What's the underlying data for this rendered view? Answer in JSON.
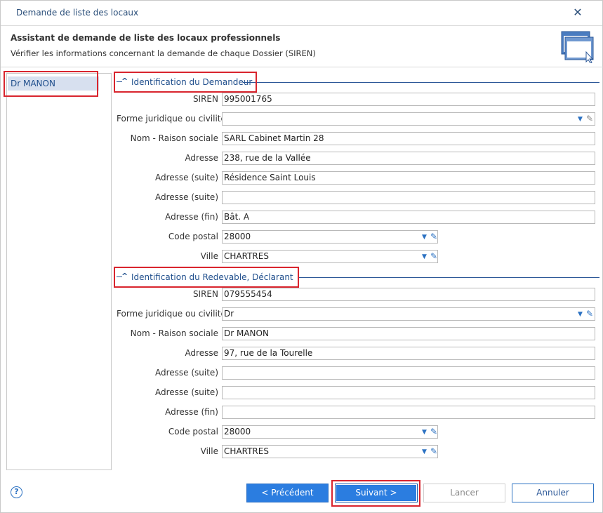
{
  "window": {
    "title": "Demande de liste des locaux",
    "close_label": "✕"
  },
  "header": {
    "title": "Assistant de demande de liste des locaux professionnels",
    "subtitle": "Vérifier les informations concernant la demande de chaque Dossier (SIREN)",
    "icon": "window-cursor-icon"
  },
  "sidebar": {
    "items": [
      {
        "label": "Dr MANON",
        "selected": true
      }
    ]
  },
  "section1": {
    "title": "Identification du Demandeur",
    "fields": {
      "siren": {
        "label": "SIREN",
        "value": "995001765"
      },
      "forme": {
        "label": "Forme juridique ou civilité",
        "value": ""
      },
      "nom": {
        "label": "Nom - Raison sociale",
        "value": "SARL Cabinet Martin 28"
      },
      "adresse": {
        "label": "Adresse",
        "value": "238, rue de la Vallée"
      },
      "adresse_suite1": {
        "label": "Adresse (suite)",
        "value": "Résidence Saint Louis"
      },
      "adresse_suite2": {
        "label": "Adresse (suite)",
        "value": ""
      },
      "adresse_fin": {
        "label": "Adresse (fin)",
        "value": "Bât. A"
      },
      "code_postal": {
        "label": "Code postal",
        "value": "28000"
      },
      "ville": {
        "label": "Ville",
        "value": "CHARTRES"
      }
    }
  },
  "section2": {
    "title": "Identification du Redevable, Déclarant",
    "fields": {
      "siren": {
        "label": "SIREN",
        "value": "079555454"
      },
      "forme": {
        "label": "Forme juridique ou civilité",
        "value": "Dr"
      },
      "nom": {
        "label": "Nom - Raison sociale",
        "value": "Dr MANON"
      },
      "adresse": {
        "label": "Adresse",
        "value": "97, rue de la Tourelle"
      },
      "adresse_suite1": {
        "label": "Adresse (suite)",
        "value": ""
      },
      "adresse_suite2": {
        "label": "Adresse (suite)",
        "value": ""
      },
      "adresse_fin": {
        "label": "Adresse (fin)",
        "value": ""
      },
      "code_postal": {
        "label": "Code postal",
        "value": "28000"
      },
      "ville": {
        "label": "Ville",
        "value": "CHARTRES"
      }
    }
  },
  "footer": {
    "help": "?",
    "prev_label": "< Précédent",
    "next_label": "Suivant >",
    "cancel_label": "Lancer",
    "annul_label": "Annuler"
  },
  "colors": {
    "accent": "#2b7de0",
    "link_text": "#1f4e8c",
    "highlight": "#d9252e",
    "selected_bg": "#d7e0ef"
  }
}
